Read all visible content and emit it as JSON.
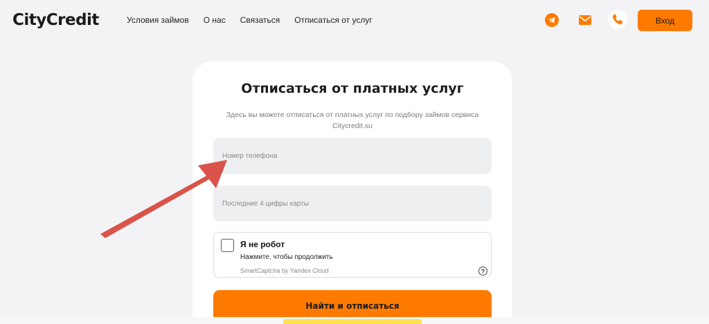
{
  "header": {
    "logo": "CityCredit",
    "nav": [
      "Условия займов",
      "О нас",
      "Связаться",
      "Отписаться от услуг"
    ],
    "login_label": "Вход"
  },
  "icons": {
    "telegram": "telegram-icon",
    "mail": "mail-icon",
    "phone": "phone-icon",
    "help": "help-icon"
  },
  "colors": {
    "accent": "#ff7a00",
    "background": "#f3f3f5",
    "card": "#ffffff",
    "annotation_arrow": "#d9534a"
  },
  "form": {
    "title": "Отписаться от платных услуг",
    "subtitle": "Здесь вы можете отписаться от платных услуг по подбору займов сервиса Citycredit.su",
    "phone_placeholder": "Номер телефона",
    "card_placeholder": "Последние 4 цифры карты",
    "captcha": {
      "title": "Я не робот",
      "subtitle": "Нажмите, чтобы продолжить",
      "brand": "SmartCaptcha by Yandex Cloud",
      "help": "?"
    },
    "submit_label": "Найти и отписаться"
  }
}
